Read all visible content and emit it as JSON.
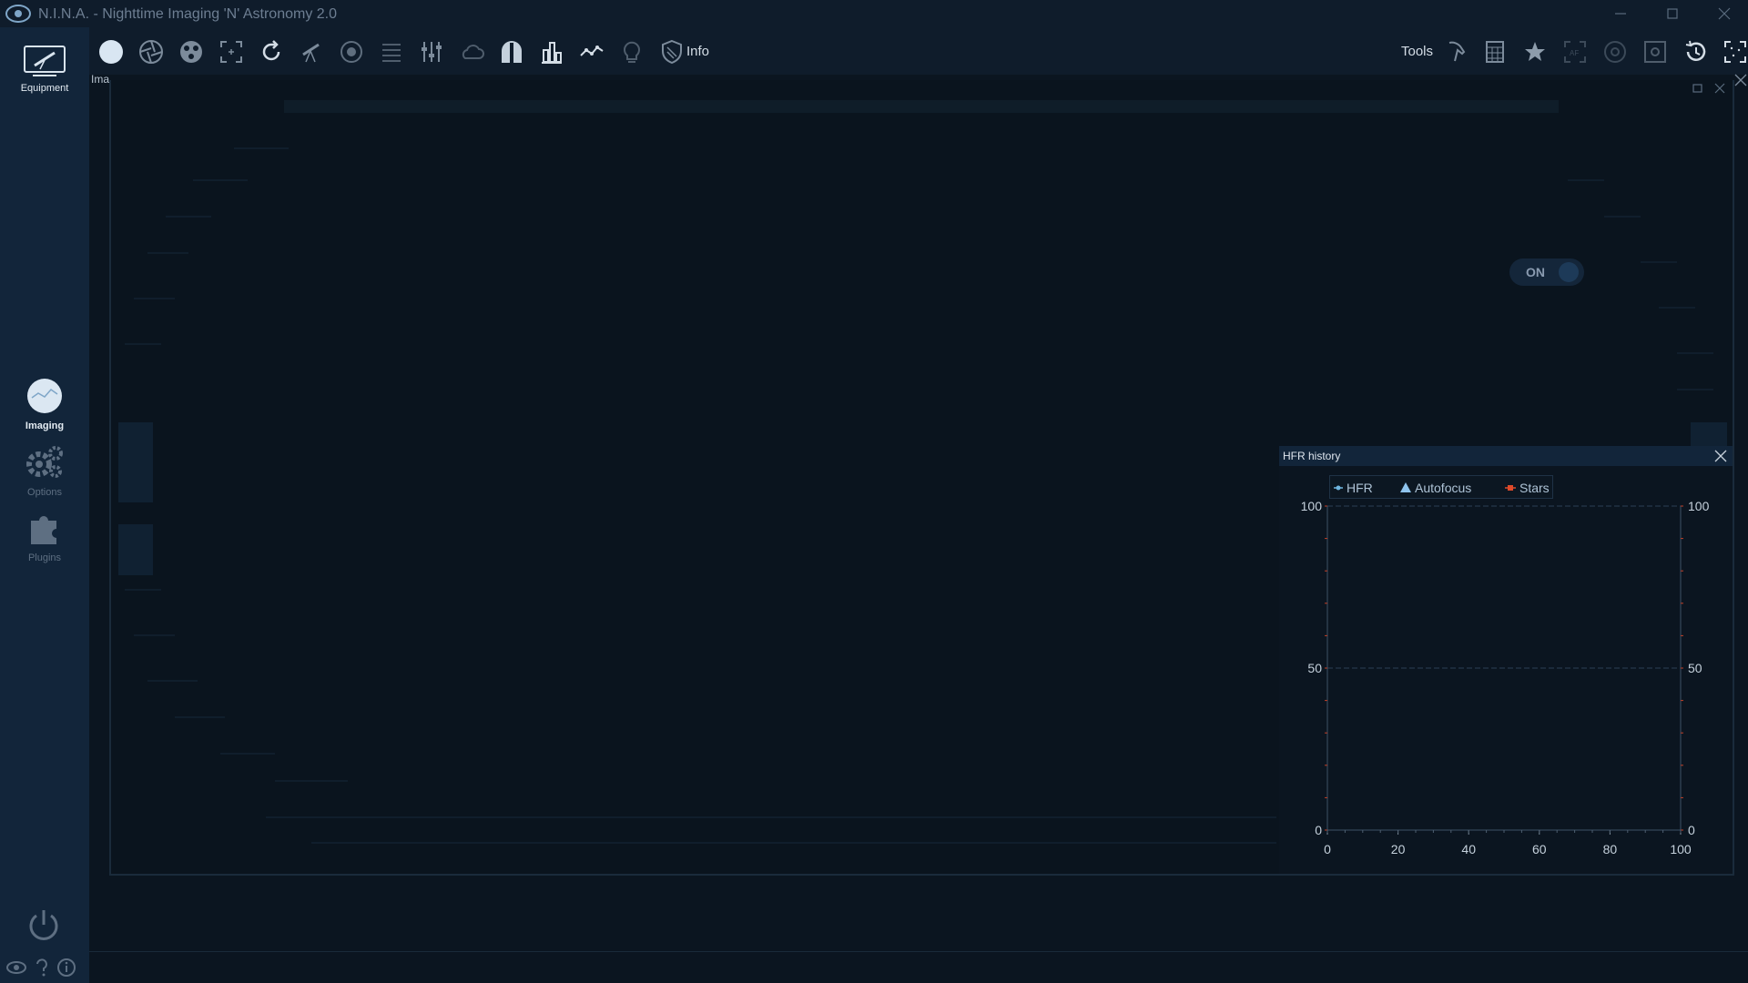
{
  "window": {
    "title": "N.I.N.A. - Nighttime Imaging 'N' Astronomy 2.0"
  },
  "sidebar": {
    "items": [
      {
        "label": "Equipment",
        "icon": "telescope-icon"
      },
      {
        "label": "Imaging",
        "icon": "imaging-icon"
      },
      {
        "label": "Options",
        "icon": "gear-icon"
      },
      {
        "label": "Plugins",
        "icon": "puzzle-icon"
      }
    ]
  },
  "toolbar": {
    "info_label": "Info",
    "tools_label": "Tools"
  },
  "dock": {
    "tab_label": "Ima"
  },
  "toggle": {
    "label": "ON"
  },
  "hfr": {
    "title": "HFR history",
    "legend": [
      {
        "label": "HFR",
        "color": "#6fb6e0"
      },
      {
        "label": "Autofocus",
        "color": "#8fc4ee"
      },
      {
        "label": "Stars",
        "color": "#e04a2a"
      }
    ]
  },
  "chart_data": {
    "type": "line",
    "series": [
      {
        "name": "HFR",
        "values": []
      },
      {
        "name": "Autofocus",
        "values": []
      },
      {
        "name": "Stars",
        "values": []
      }
    ],
    "x_ticks": [
      "0",
      "20",
      "40",
      "60",
      "80",
      "100"
    ],
    "y_left_ticks": [
      "0",
      "50",
      "100"
    ],
    "y_right_ticks": [
      "0",
      "50",
      "100"
    ],
    "xlim": [
      0,
      100
    ],
    "ylim": [
      0,
      100
    ],
    "grid": true,
    "legend_position": "top-left"
  },
  "colors": {
    "background": "#0b1520",
    "panel": "#12253a",
    "accent": "#6fb6e0",
    "stars": "#e04a2a"
  }
}
